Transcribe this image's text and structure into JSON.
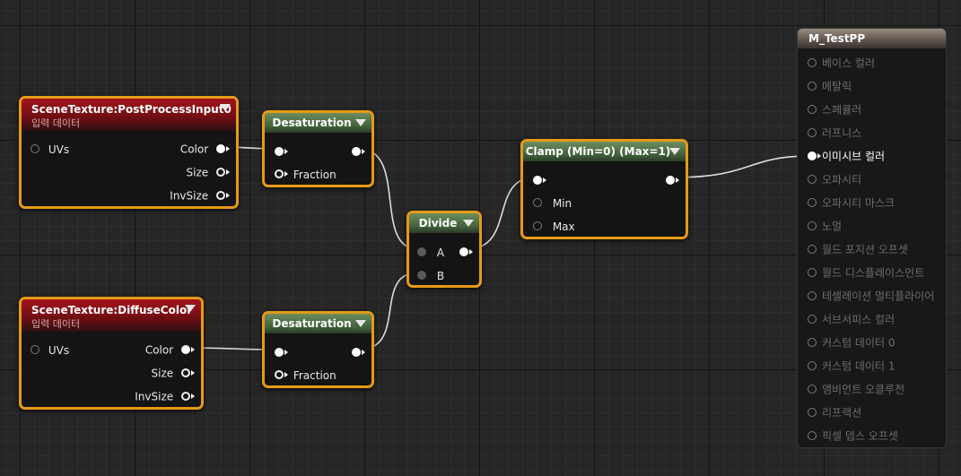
{
  "nodes": {
    "scene_tex_1": {
      "title": "SceneTexture:PostProcessInput0",
      "subtitle": "입력 데이터",
      "in_pin": "UVs",
      "out_pins": [
        "Color",
        "Size",
        "InvSize"
      ]
    },
    "scene_tex_2": {
      "title": "SceneTexture:DiffuseColor",
      "subtitle": "입력 데이터",
      "in_pin": "UVs",
      "out_pins": [
        "Color",
        "Size",
        "InvSize"
      ]
    },
    "desat_1": {
      "title": "Desaturation",
      "fraction_label": "Fraction"
    },
    "desat_2": {
      "title": "Desaturation",
      "fraction_label": "Fraction"
    },
    "divide": {
      "title": "Divide",
      "pin_a": "A",
      "pin_b": "B"
    },
    "clamp": {
      "title": "Clamp (Min=0) (Max=1)",
      "pin_min": "Min",
      "pin_max": "Max"
    }
  },
  "result_node": {
    "title": "M_TestPP",
    "inputs": [
      "베이스 컬러",
      "메탈릭",
      "스페큘러",
      "러프니스",
      "이미시브 컬러",
      "오파시티",
      "오파시티 마스크",
      "노멀",
      "월드 포지션 오프셋",
      "월드 디스플레이스먼트",
      "테셀레이션 멀티플라이어",
      "서브서피스 컬러",
      "커스텀 데이터 0",
      "커스텀 데이터 1",
      "앰비언트 오클루전",
      "리프랙션",
      "픽셀 뎁스 오프셋"
    ],
    "active_input": "이미시브 컬러"
  },
  "colors": {
    "background": "#262626",
    "node_border_selected": "#e69a16",
    "scene_texture_header": "#a3141b",
    "function_header": "#5a7a4e",
    "result_header": "#8a7d72",
    "wire": "#e0e0e0"
  },
  "icons": [
    "collapse-arrow-icon",
    "pin-filled-icon",
    "pin-hollow-icon"
  ]
}
